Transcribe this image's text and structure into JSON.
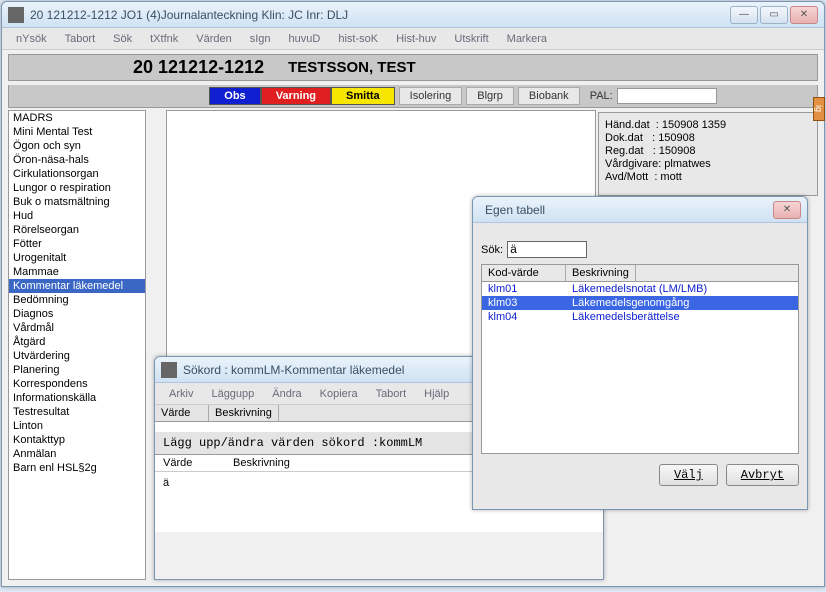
{
  "main": {
    "title": "20 121212-1212    JO1 (4)Journalanteckning            Klin: JC  Inr: DLJ",
    "menu": [
      "nYsök",
      "Tabort",
      "Sök",
      "tXtfnk",
      "Värden",
      "sIgn",
      "huvuD",
      "hist-soK",
      "Hist-huv",
      "Utskrift",
      "Markera"
    ],
    "patient_id": "20 121212-1212",
    "patient_name": "TESTSSON, TEST",
    "tags": [
      {
        "label": "Obs",
        "cls": "blue"
      },
      {
        "label": "Varning",
        "cls": "red"
      },
      {
        "label": "Smitta",
        "cls": "yellow"
      }
    ],
    "plain_tags": [
      "Isolering",
      "Blgrp",
      "Biobank"
    ],
    "pal_label": "PAL:"
  },
  "sidebar": [
    "MADRS",
    "Mini Mental Test",
    "Ögon och syn",
    "Öron-näsa-hals",
    "Cirkulationsorgan",
    "Lungor o respiration",
    "Buk o matsmältning",
    "Hud",
    "Rörelseorgan",
    "Fötter",
    "Urogenitalt",
    "Mammae",
    "Kommentar läkemedel",
    "Bedömning",
    "Diagnos",
    "Vårdmål",
    "Åtgärd",
    "Utvärdering",
    "Planering",
    "Korrespondens",
    "Informationskälla",
    "Testresultat",
    "Linton",
    "Kontakttyp",
    "Anmälan",
    "Barn enl HSL§2g"
  ],
  "sidebar_sel": 12,
  "info": {
    "line1": "Händ.dat  : 150908 1359",
    "line2": "Dok.dat   : 150908",
    "line3": "Reg.dat   : 150908",
    "line4": "Vårdgivare: plmatwes",
    "line5": "Avd/Mott  : mott"
  },
  "dlg1": {
    "title": "Sökord : kommLM-Kommentar läkemedel",
    "menu": [
      "Arkiv",
      "Läggupp",
      "Ändra",
      "Kopiera",
      "Tabort",
      "Hjälp"
    ],
    "col1": "Värde",
    "col2": "Beskrivning",
    "sec": "Lägg upp/ändra värden sökord :kommLM",
    "val_col1": "Värde",
    "val_col2": "Beskrivning",
    "cur_val": "ä"
  },
  "dlg2": {
    "title": "Egen tabell",
    "sok_label": "Sök:",
    "sok_val": "ä",
    "col1": "Kod-värde",
    "col2": "Beskrivning",
    "rows": [
      {
        "k": "klm01",
        "b": "Läkemedelsnotat (LM/LMB)"
      },
      {
        "k": "klm03",
        "b": "Läkemedelsgenomgång"
      },
      {
        "k": "klm04",
        "b": "Läkemedelsberättelse"
      }
    ],
    "sel": 1,
    "btn_valj": "Välj",
    "btn_avbryt": "Avbryt"
  },
  "sidetab": "ig"
}
